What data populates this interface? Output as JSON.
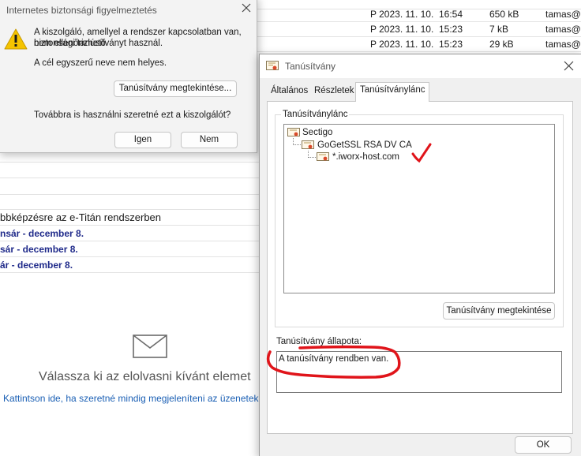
{
  "mail_list": {
    "rows": [
      {
        "date": "P 2023. 11. 10.",
        "time": "16:54",
        "size": "650 kB",
        "from": "tamas@"
      },
      {
        "date": "P 2023. 11. 10.",
        "time": "15:23",
        "size": "7 kB",
        "from": "tamas@"
      },
      {
        "date": "P 2023. 11. 10.",
        "time": "15:23",
        "size": "29 kB",
        "from": "tamas@"
      }
    ],
    "subjects": [
      "bbképzésre az e-Titán rendszerben",
      "nsár - december 8.",
      "sár - december 8.",
      "ár - december 8."
    ],
    "empty_message": "Válassza ki az elolvasni kívánt elemet",
    "empty_link": "Kattintson ide, ha szeretné mindig megjeleníteni az üzenetek e"
  },
  "security_dialog": {
    "title": "Internetes biztonsági figyelmeztetés",
    "message_line1": "A kiszolgáló, amellyel a rendszer kapcsolatban van, nem ellenőrizhető",
    "message_line2": "biztonsági tanúsítványt használ.",
    "message_line3": "A cél egyszerű neve nem helyes.",
    "view_cert_button": "Tanúsítvány megtekintése...",
    "question": "Továbbra is használni szeretné ezt a kiszolgálót?",
    "yes_button": "Igen",
    "no_button": "Nem"
  },
  "cert_dialog": {
    "title": "Tanúsítvány",
    "tabs": [
      "Általános",
      "Részletek",
      "Tanúsítványlánc"
    ],
    "active_tab": "Tanúsítványlánc",
    "chain_group_label": "Tanúsítványlánc",
    "chain": [
      "Sectigo",
      "GoGetSSL RSA DV CA",
      "*.iworx-host.com"
    ],
    "view_cert_button": "Tanúsítvány megtekintése",
    "status_label": "Tanúsítvány állapota:",
    "status_text": "A tanúsítvány rendben van.",
    "ok_button": "OK"
  },
  "colors": {
    "accent_link": "#1a5fb4",
    "annotation_red": "#e0141a",
    "warning_yellow": "#f5c400"
  }
}
